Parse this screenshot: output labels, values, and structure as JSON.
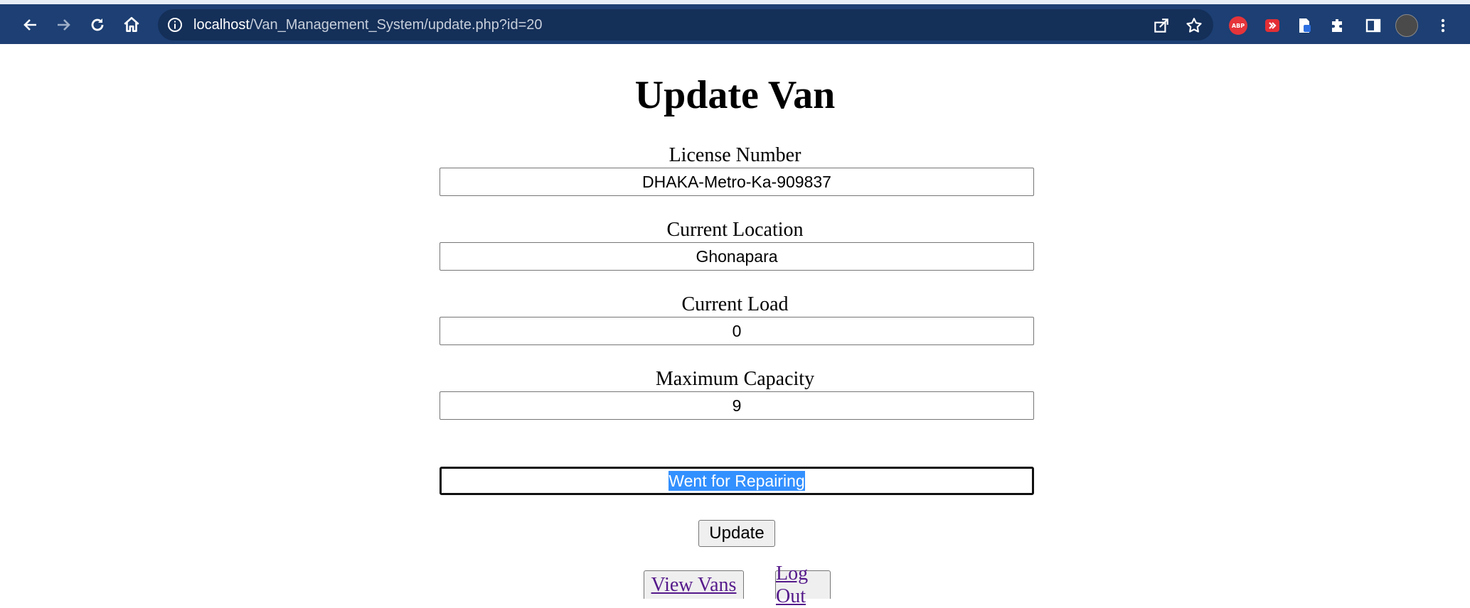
{
  "browser": {
    "url_host": "localhost",
    "url_path": "/Van_Management_System/update.php?id=20",
    "extensions": [
      "share-icon",
      "bookmark-star-icon",
      "adblock-plus-icon",
      "extension-red-icon",
      "extension-blue-icon",
      "puzzle-icon",
      "sidepanel-icon",
      "profile-avatar",
      "menu-icon"
    ],
    "abp_label": "ABP"
  },
  "page": {
    "title": "Update Van",
    "fields": [
      {
        "label": "License Number",
        "value": "DHAKA-Metro-Ka-909837"
      },
      {
        "label": "Current Location",
        "value": "Ghonapara"
      },
      {
        "label": "Current Load",
        "value": "0"
      },
      {
        "label": "Maximum Capacity",
        "value": "9"
      }
    ],
    "status_value": "Went for Repairing",
    "update_button": "Update",
    "view_vans_link": "View Vans",
    "logout_link": "Log Out"
  },
  "colors": {
    "toolbar": "#1d3f73",
    "omnibox": "#142f58",
    "selection": "#3390ff",
    "link": "#551a8b"
  }
}
